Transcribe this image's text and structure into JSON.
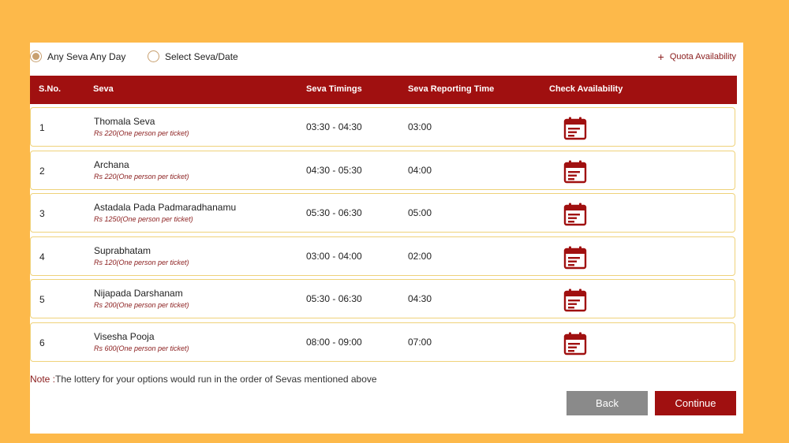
{
  "options": {
    "any_seva": "Any Seva Any Day",
    "select_seva": "Select Seva/Date",
    "quota": "Quota Availability",
    "quota_icon": "plus-icon"
  },
  "table": {
    "headers": [
      "S.No.",
      "Seva",
      "Seva Timings",
      "Seva Reporting Time",
      "Check Availability"
    ],
    "rows": [
      {
        "sno": "1",
        "name": "Thomala Seva",
        "price": "Rs 220(One person per ticket)",
        "timing": "03:30 - 04:30",
        "report": "03:00"
      },
      {
        "sno": "2",
        "name": "Archana",
        "price": "Rs 220(One person per ticket)",
        "timing": "04:30 - 05:30",
        "report": "04:00"
      },
      {
        "sno": "3",
        "name": "Astadala Pada Padmaradhanamu",
        "price": "Rs 1250(One person per ticket)",
        "timing": "05:30 - 06:30",
        "report": "05:00"
      },
      {
        "sno": "4",
        "name": "Suprabhatam",
        "price": "Rs 120(One person per ticket)",
        "timing": "03:00 - 04:00",
        "report": "02:00"
      },
      {
        "sno": "5",
        "name": "Nijapada Darshanam",
        "price": "Rs 200(One person per ticket)",
        "timing": "05:30 - 06:30",
        "report": "04:30"
      },
      {
        "sno": "6",
        "name": "Visesha Pooja",
        "price": "Rs 600(One person per ticket)",
        "timing": "08:00 - 09:00",
        "report": "07:00"
      }
    ],
    "availability_icon": "calendar-icon"
  },
  "note": {
    "label": "Note :",
    "text": "The lottery for your options would run in the order of Sevas mentioned above"
  },
  "buttons": {
    "back": "Back",
    "continue": "Continue"
  },
  "colors": {
    "accent": "#A01010",
    "background": "#FDB94A",
    "row_border": "#EFD27A",
    "back_button": "#8a8a8a"
  }
}
